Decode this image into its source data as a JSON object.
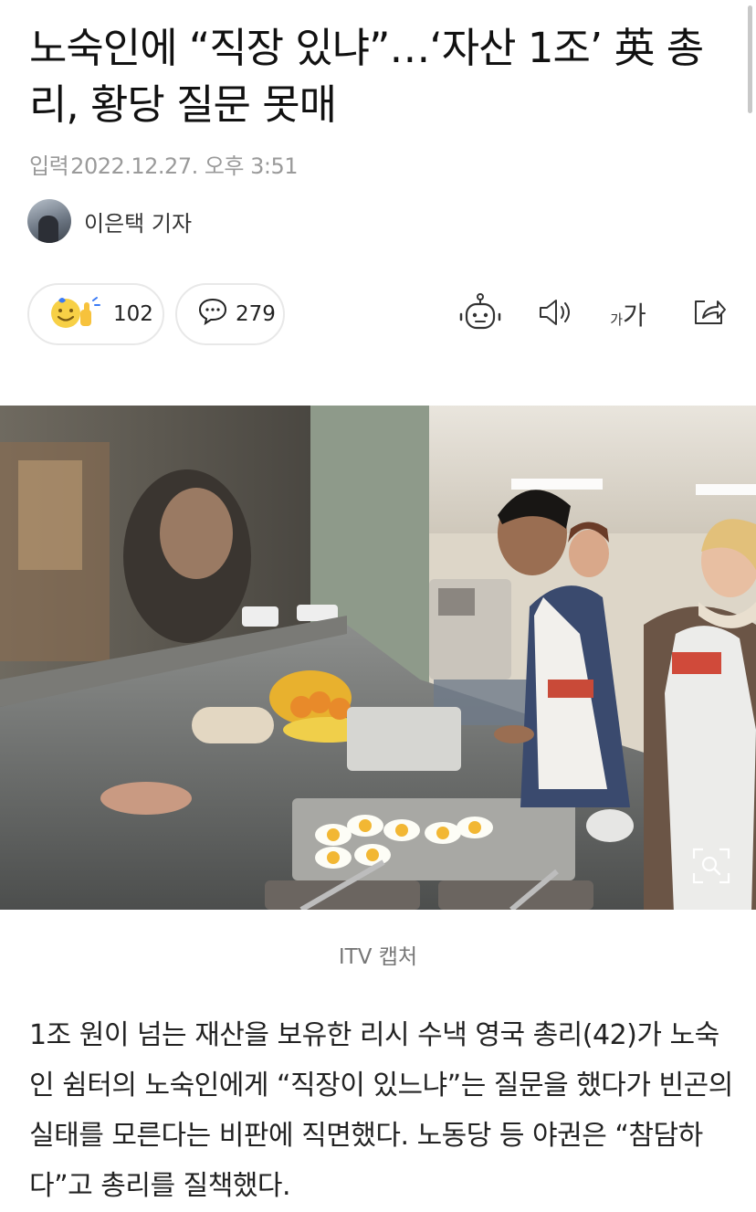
{
  "article": {
    "title": "노숙인에 “직장 있냐”…‘자산 1조’ 英 총리, 황당 질문 못매",
    "published_label": "입력",
    "published_at": "2022.12.27. 오후 3:51",
    "author": "이은택 기자"
  },
  "actions": {
    "reaction_count": "102",
    "comment_count": "279",
    "tools": [
      "robot-summary-icon",
      "speaker-icon",
      "font-size-icon",
      "share-icon"
    ],
    "font_size_small": "가",
    "font_size_large": "가"
  },
  "photo": {
    "caption": "ITV 캡처",
    "zoom_icon": "zoom-icon"
  },
  "body": {
    "paragraph": "1조 원이 넘는 재산을 보유한 리시 수낵 영국 총리(42)가 노숙인 쉼터의 노숙인에게 “직장이 있느냐”는 질문을 했다가 빈곤의 실태를 모른다는 비판에 직면했다. 노동당 등 야권은 “참담하다”고 총리를 질책했다."
  },
  "colors": {
    "meta_text": "#9a9a9a",
    "pill_border": "#e8e8e8",
    "emoji_yellow": "#f7d046",
    "emoji_blue": "#3b7bf6"
  }
}
